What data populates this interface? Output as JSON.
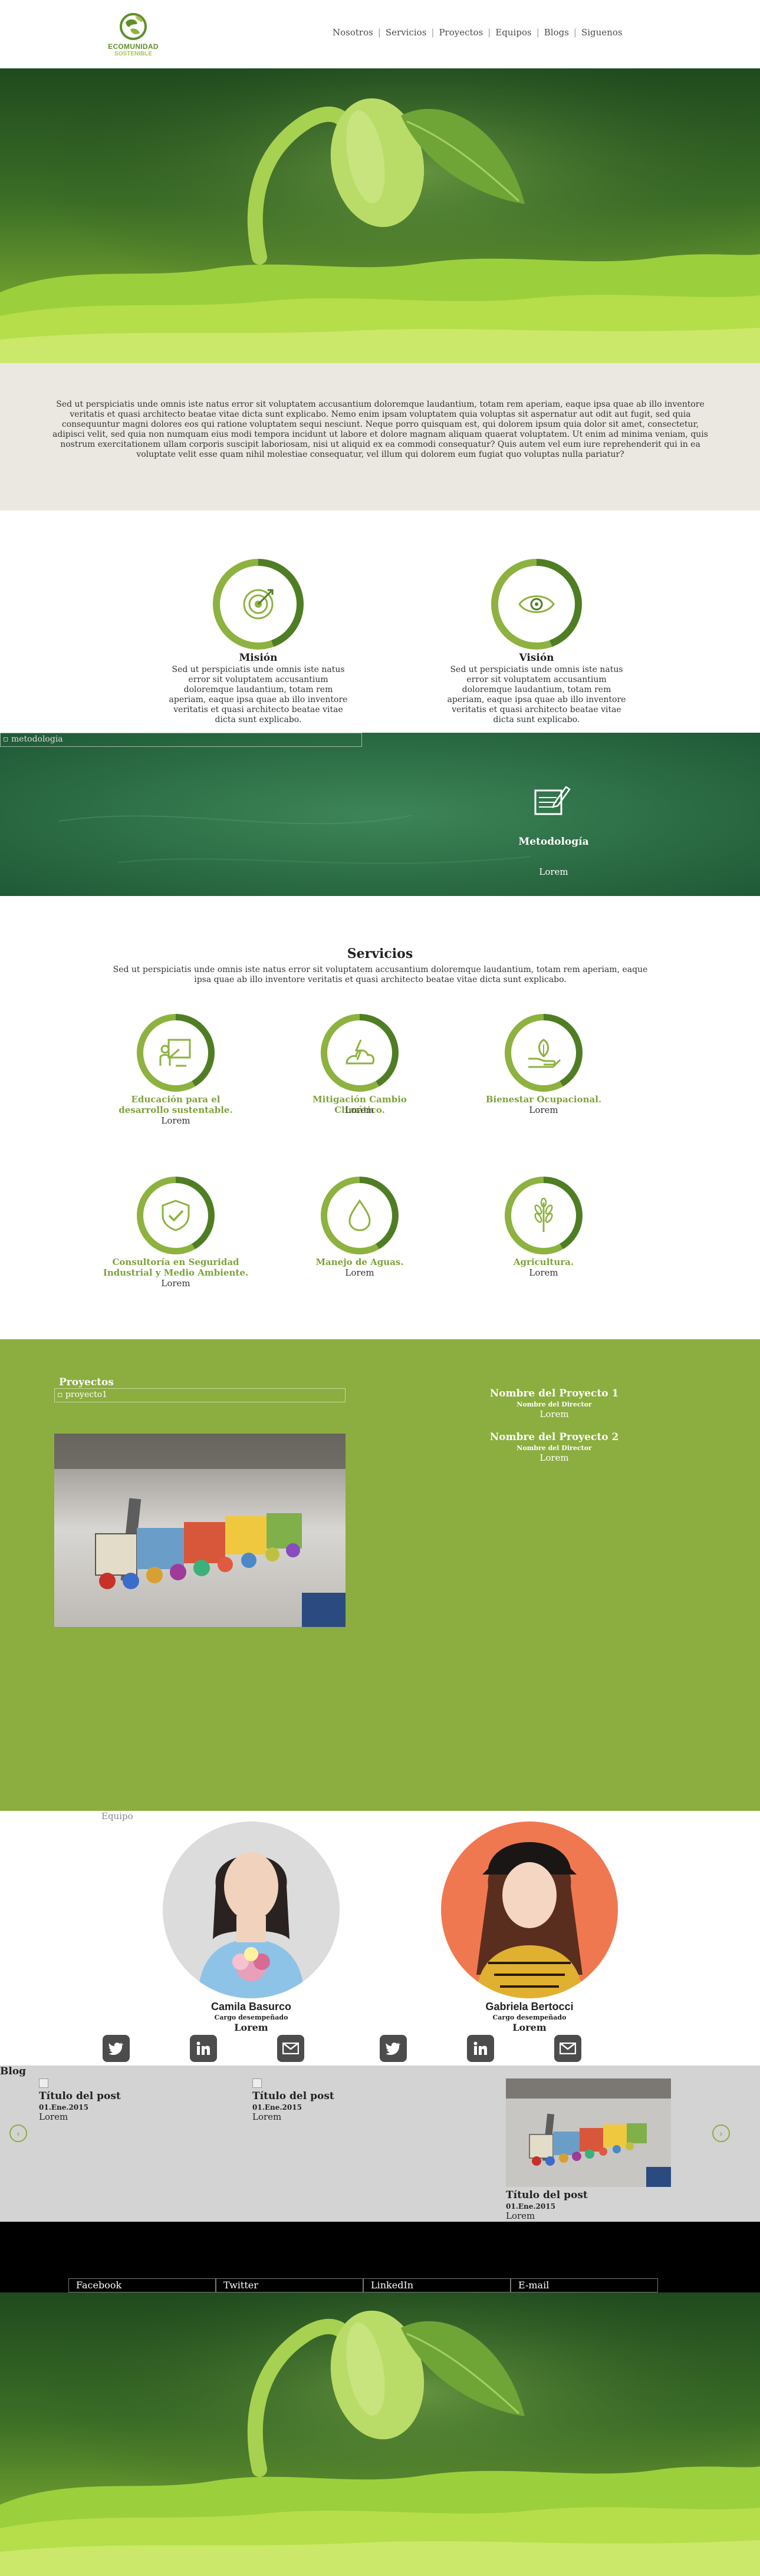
{
  "header": {
    "logo_line1": "ECOMUNIDAD",
    "logo_line2": "SOSTENIBLE",
    "nav": [
      "Nosotros",
      "Servicios",
      "Proyectos",
      "Equipos",
      "Blogs",
      "Siguenos"
    ],
    "separator": "|"
  },
  "intro": {
    "text": "Sed ut perspiciatis unde omnis iste natus error sit voluptatem accusantium doloremque laudantium, totam rem aperiam, eaque ipsa quae ab illo inventore veritatis et quasi architecto beatae vitae dicta sunt explicabo. Nemo enim ipsam voluptatem quia voluptas sit aspernatur aut odit aut fugit, sed quia consequuntur magni dolores eos qui ratione voluptatem sequi nesciunt. Neque porro quisquam est, qui dolorem ipsum quia dolor sit amet, consectetur, adipisci velit, sed quia non numquam eius modi tempora incidunt ut labore et dolore magnam aliquam quaerat voluptatem. Ut enim ad minima veniam, quis nostrum exercitationem ullam corporis suscipit laboriosam, nisi ut aliquid ex ea commodi consequatur? Quis autem vel eum iure reprehenderit qui in ea voluptate velit esse quam nihil molestiae consequatur, vel illum qui dolorem eum fugiat quo voluptas nulla pariatur?"
  },
  "mission": {
    "title": "Misión",
    "text": "Sed ut perspiciatis unde omnis iste natus error sit voluptatem accusantium doloremque laudantium, totam rem aperiam, eaque ipsa quae ab illo inventore veritatis et quasi architecto beatae vitae dicta sunt explicabo."
  },
  "vision": {
    "title": "Visión",
    "text": "Sed ut perspiciatis unde omnis iste natus error sit voluptatem accusantium doloremque laudantium, totam rem aperiam, eaque ipsa quae ab illo inventore veritatis et quasi architecto beatae vitae dicta sunt explicabo."
  },
  "metodologia": {
    "broken_alt": "metodologia",
    "title": "Metodología",
    "sub": "Lorem"
  },
  "servicios": {
    "title": "Servicios",
    "intro": "Sed ut perspiciatis unde omnis iste natus error sit voluptatem accusantium doloremque laudantium, totam rem aperiam, eaque ipsa quae ab illo inventore veritatis et quasi architecto beatae vitae dicta sunt explicabo.",
    "items": [
      {
        "label": "Educación para el desarrollo sustentable.",
        "sub": "Lorem",
        "icon": "education-icon"
      },
      {
        "label": "Mitigación Cambio Climático.",
        "sub": "Lorem",
        "icon": "climate-icon"
      },
      {
        "label": "Bienestar Ocupacional.",
        "sub": "Lorem",
        "icon": "wellbeing-icon"
      },
      {
        "label": "Consultoría en Seguridad Industrial y Medio Ambiente.",
        "sub": "Lorem",
        "icon": "safety-shield-icon"
      },
      {
        "label": "Manejo de Aguas.",
        "sub": "Lorem",
        "icon": "water-drop-icon"
      },
      {
        "label": "Agricultura.",
        "sub": "Lorem",
        "icon": "wheat-icon"
      }
    ]
  },
  "proyectos": {
    "heading": "Proyectos",
    "broken_alt": "proyecto1",
    "items": [
      {
        "title": "Nombre del Proyecto 1",
        "sub": "Nombre del Director",
        "lorem": "Lorem"
      },
      {
        "title": "Nombre del Proyecto 2",
        "sub": "Nombre del Director",
        "lorem": "Lorem"
      }
    ]
  },
  "equipo": {
    "heading": "Equipo",
    "members": [
      {
        "name": "Camila Basurco",
        "role": "Cargo desempeñado",
        "lorem": "Lorem"
      },
      {
        "name": "Gabriela Bertocci",
        "role": "Cargo desempeñado",
        "lorem": "Lorem"
      }
    ]
  },
  "blog": {
    "heading": "Blog",
    "posts": [
      {
        "title": "Título del post",
        "date": "01.Ene.2015",
        "lorem": "Lorem"
      },
      {
        "title": "Título del post",
        "date": "01.Ene.2015",
        "lorem": "Lorem"
      },
      {
        "title": "Título del post",
        "date": "01.Ene.2015",
        "lorem": "Lorem"
      }
    ],
    "prev": "‹",
    "next": "›"
  },
  "footer": {
    "links": [
      "Facebook",
      "Twitter",
      "LinkedIn",
      "E-mail"
    ]
  },
  "colors": {
    "brand_green": "#8cad3f",
    "dark_green": "#4f7d24",
    "chalkboard": "#2e7148",
    "intro_bg": "#ebe8e1"
  }
}
